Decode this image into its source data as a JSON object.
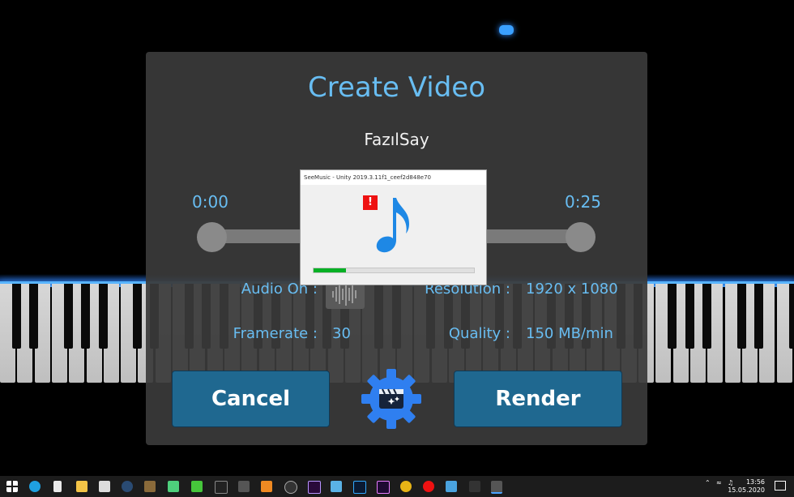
{
  "dialog": {
    "title": "Create Video",
    "song_name": "FazılSay",
    "start_time": "0:00",
    "end_time": "0:25",
    "audio_label": "Audio On :",
    "resolution_label": "Resolution :",
    "resolution_value": "1920 x 1080",
    "framerate_label": "Framerate :",
    "framerate_value": "30",
    "quality_label": "Quality :",
    "quality_value": "150 MB/min",
    "cancel_label": "Cancel",
    "render_label": "Render",
    "accent_color": "#68bdf2",
    "button_color": "#1f6890"
  },
  "loading_window": {
    "title": "SeeMusic - Unity 2019.3.11f1_ceef2d848e70",
    "warning_mark": "!",
    "progress": 0.2,
    "icon": "music-note-icon"
  },
  "taskbar": {
    "time": "13:56",
    "date": "15.05.2020"
  }
}
